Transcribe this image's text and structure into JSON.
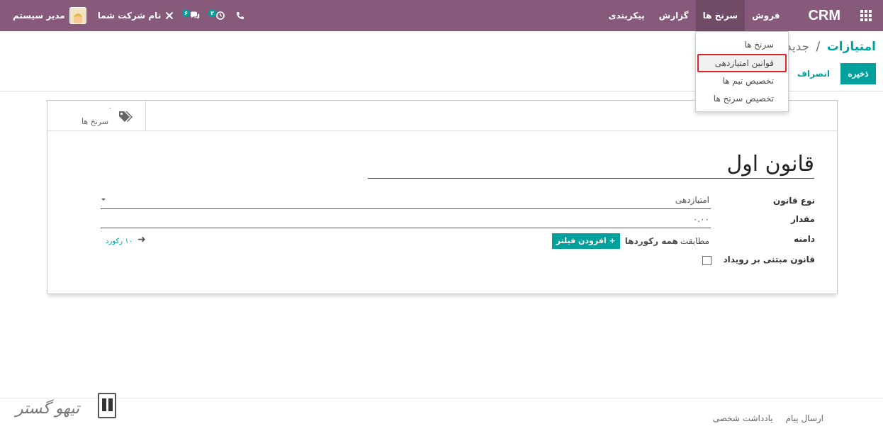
{
  "navbar": {
    "brand": "CRM",
    "menus": [
      {
        "label": "فروش"
      },
      {
        "label": "سرنخ ها",
        "active": true
      },
      {
        "label": "گزارش"
      },
      {
        "label": "پیکربندی"
      }
    ],
    "phone_icon": "phone-icon",
    "activities_badge": "۲",
    "messages_badge": "۶",
    "company": "نام شرکت شما",
    "user": "مدیر سیستم"
  },
  "breadcrumb": {
    "parent": "امتیازات",
    "separator": "/",
    "current": "جدید"
  },
  "buttons": {
    "save": "ذخیره",
    "discard": "انصراف"
  },
  "dropdown": {
    "items": [
      {
        "label": "سرنخ ها"
      },
      {
        "label": "قوانین امتیازدهی",
        "highlighted": true
      },
      {
        "label": "تخصیص تیم ها"
      },
      {
        "label": "تخصیص سرنخ ها"
      }
    ]
  },
  "sheet": {
    "smart_button": {
      "count": "۰",
      "label": "سرنخ ها"
    },
    "title": "قانون اول",
    "fields": {
      "rule_type_label": "نوع قانون",
      "rule_type_value": "امتیازدهی",
      "amount_label": "مقدار",
      "amount_value": "۰.۰۰",
      "domain_label": "دامنه",
      "domain_match": "مطابقت",
      "domain_all": "همه رکوردها",
      "add_filter": "افزودن فیلتر",
      "record_count": "۱۰ رکورد",
      "event_based_label": "قانون مبتنی بر رویداد"
    }
  },
  "chatter": {
    "send_message": "ارسال پیام",
    "log_note": "یادداشت شخصی"
  },
  "watermark": {
    "text": "تیهو گستر"
  },
  "colors": {
    "navbar": "#875a7b",
    "accent": "#00a09d",
    "highlight_border": "#d9262b"
  }
}
